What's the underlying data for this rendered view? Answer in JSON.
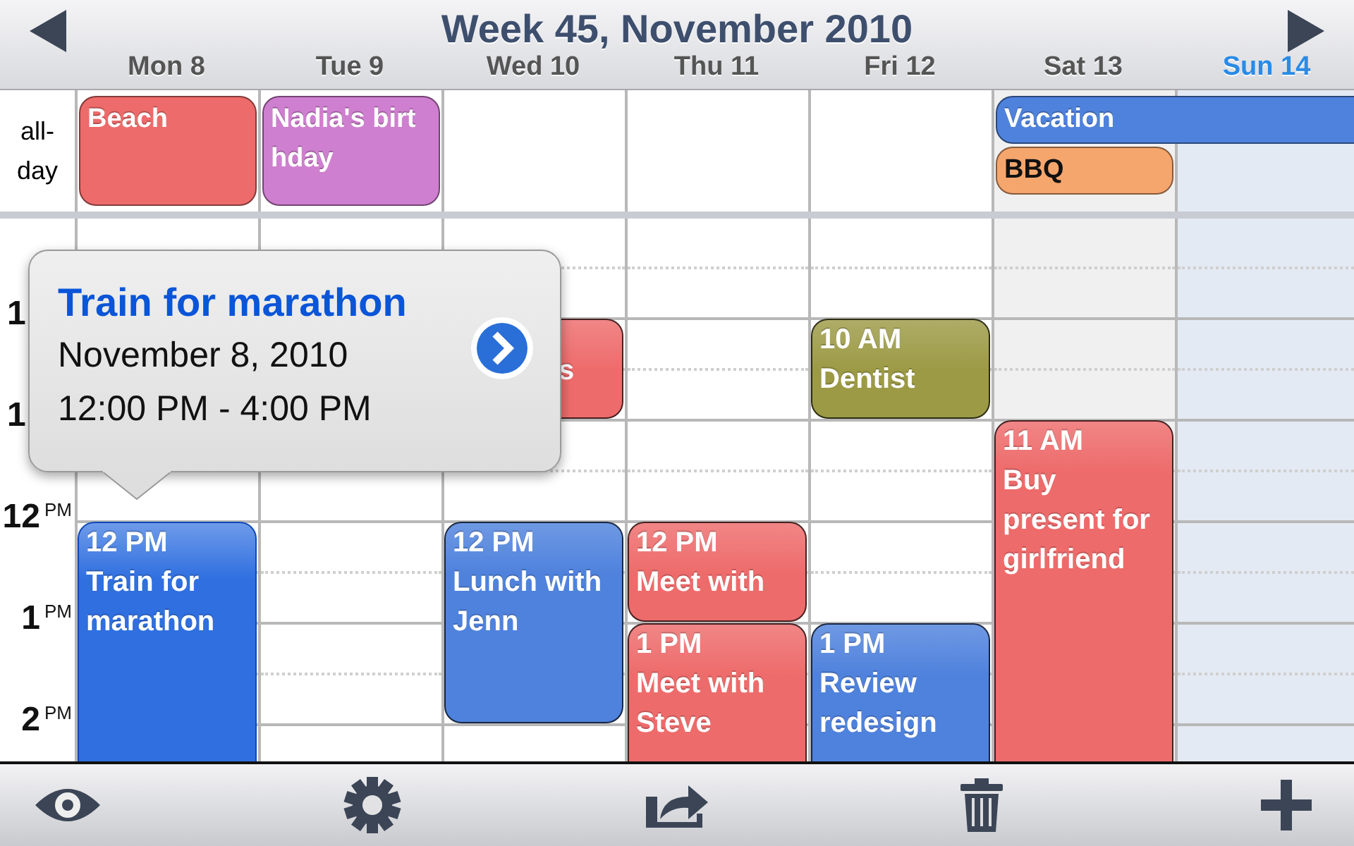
{
  "header": {
    "title": "Week 45, November 2010"
  },
  "days": [
    {
      "label": "Mon 8",
      "today": false,
      "weekend": false,
      "all_day": [
        {
          "title": "Beach",
          "color": "#ee6b6b",
          "continues": false
        }
      ],
      "events": [
        {
          "time": "12 PM",
          "title": "Train for marathon",
          "kind": "open",
          "color": "#2f6fe0",
          "selected": true
        }
      ]
    },
    {
      "label": "Tue 9",
      "today": false,
      "weekend": false,
      "all_day": [
        {
          "title": "Nadia's birthday",
          "color": "#cf7fcf",
          "continues": false
        }
      ]
    },
    {
      "label": "Wed 10",
      "today": false,
      "weekend": false,
      "events": [
        {
          "title": "s",
          "kind": "covered",
          "color": "#ee6b6b",
          "selected": false
        },
        {
          "time": "12 PM",
          "title": "Lunch with Jenn",
          "kind": "two-hour",
          "color": "#4f82dd",
          "selected": false
        }
      ]
    },
    {
      "label": "Thu 11",
      "today": false,
      "weekend": false,
      "events": [
        {
          "time": "12 PM",
          "title": "Meet with",
          "kind": "one-hour",
          "color": "#ee6b6b",
          "selected": false
        },
        {
          "time": "1 PM",
          "title": "Meet with Steve",
          "kind": "open",
          "color": "#ee6b6b",
          "selected": false
        }
      ]
    },
    {
      "label": "Fri 12",
      "today": false,
      "weekend": false,
      "events": [
        {
          "time": "10 AM",
          "title": "Dentist",
          "kind": "one-hour",
          "color": "#9c9a45",
          "selected": false
        },
        {
          "time": "1 PM",
          "title": "Review redesign",
          "kind": "open",
          "color": "#4f82dd",
          "selected": false
        }
      ]
    },
    {
      "label": "Sat 13",
      "today": false,
      "weekend": true,
      "all_day": [
        {
          "title": "Vacation",
          "color": "#4f82dd",
          "continues": true
        },
        {
          "title": "BBQ",
          "color": "#f5a66d",
          "continues": false
        }
      ],
      "events": [
        {
          "time": "11 AM",
          "title": "Buy present for girlfriend",
          "kind": "open",
          "color": "#ee6b6b",
          "selected": false
        }
      ]
    },
    {
      "label": "Sun 14",
      "today": true,
      "weekend": true
    }
  ],
  "all_day_label": "all-day",
  "hours": [
    {
      "hour": "1"
    },
    {
      "hour": "1"
    },
    {
      "hour": "12",
      "suffix": "PM"
    },
    {
      "hour": "1",
      "suffix": "PM"
    },
    {
      "hour": "2",
      "suffix": "PM"
    }
  ],
  "popover": {
    "title": "Train for marathon",
    "date": "November 8, 2010",
    "time": "12:00 PM - 4:00 PM"
  },
  "toolbar": [
    {
      "kind": "eye"
    },
    {
      "kind": "gear"
    },
    {
      "kind": "share"
    },
    {
      "kind": "trash"
    },
    {
      "kind": "add"
    }
  ]
}
